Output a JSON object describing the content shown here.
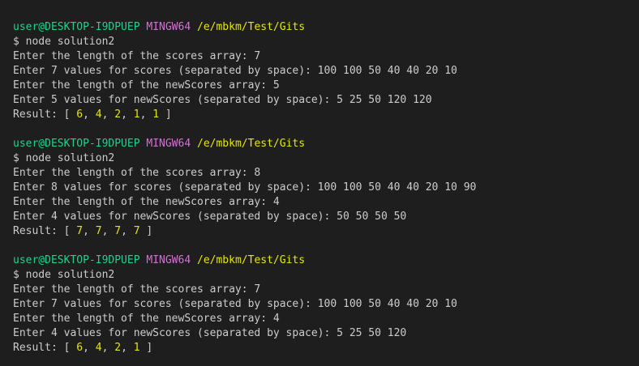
{
  "prompt": {
    "user_host": "user@DESKTOP-I9DPUEP",
    "system": "MINGW64",
    "path": "/e/mbkm/Test/Gits",
    "command": "$ node solution2"
  },
  "runs": [
    {
      "lines": [
        "Enter the length of the scores array: 7",
        "Enter 7 values for scores (separated by space): 100 100 50 40 40 20 10",
        "Enter the length of the newScores array: 5",
        "Enter 5 values for newScores (separated by space): 5 25 50 120 120"
      ],
      "result_label": "Result: ",
      "result": [
        "6",
        "4",
        "2",
        "1",
        "1"
      ]
    },
    {
      "lines": [
        "Enter the length of the scores array: 8",
        "Enter 8 values for scores (separated by space): 100 100 50 40 40 20 10 90",
        "Enter the length of the newScores array: 4",
        "Enter 4 values for newScores (separated by space): 50 50 50 50"
      ],
      "result_label": "Result: ",
      "result": [
        "7",
        "7",
        "7",
        "7"
      ]
    },
    {
      "lines": [
        "Enter the length of the scores array: 7",
        "Enter 7 values for scores (separated by space): 100 100 50 40 40 20 10",
        "Enter the length of the newScores array: 4",
        "Enter 4 values for newScores (separated by space): 5 25 50 120"
      ],
      "result_label": "Result: ",
      "result": [
        "6",
        "4",
        "2",
        "1"
      ]
    }
  ],
  "colors": {
    "background": "#1e1e1e",
    "text": "#cccccc",
    "user_host": "#23d18b",
    "system": "#d670d6",
    "path": "#e5e510",
    "numbers": "#e5e510"
  }
}
